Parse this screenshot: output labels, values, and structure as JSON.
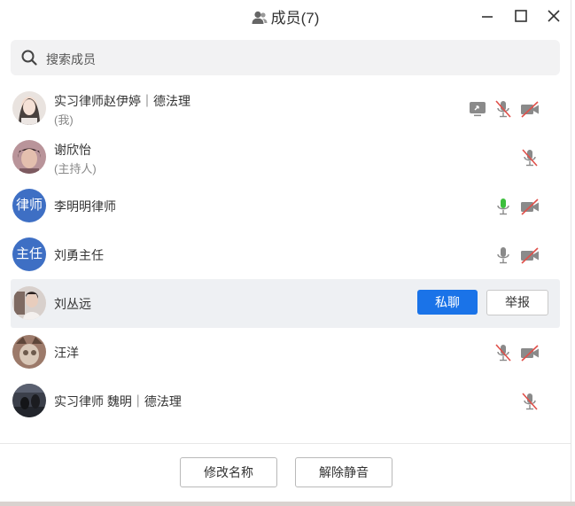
{
  "window": {
    "title": "成员(7)",
    "controls": [
      "minimize",
      "maximize",
      "close"
    ]
  },
  "search": {
    "placeholder": "搜索成员"
  },
  "members": [
    {
      "name": "实习律师赵伊婷｜德法理",
      "sub": "(我)",
      "avatar": "photo",
      "screen_share": true,
      "mic": "muted",
      "camera": "off"
    },
    {
      "name": "谢欣怡",
      "sub": "(主持人)",
      "avatar": "photo",
      "mic": "muted"
    },
    {
      "name": "李明明律师",
      "avatar_text": "律师",
      "mic": "active",
      "camera": "off"
    },
    {
      "name": "刘勇主任",
      "avatar_text": "主任",
      "mic": "on",
      "camera": "off"
    },
    {
      "name": "刘丛远",
      "avatar": "photo",
      "highlighted": true,
      "actions": {
        "chat_label": "私聊",
        "report_label": "举报"
      }
    },
    {
      "name": "汪洋",
      "avatar": "photo",
      "mic": "muted",
      "camera": "off"
    },
    {
      "name": "实习律师 魏明｜德法理",
      "avatar": "photo",
      "mic": "muted"
    }
  ],
  "footer": {
    "rename_label": "修改名称",
    "unmute_label": "解除静音"
  },
  "colors": {
    "accent": "#1a73e8",
    "avatar_blue": "#3e6fc4",
    "mic_active": "#3dbf3d",
    "muted_red": "#e0504a",
    "icon_gray": "#8a8a8a"
  }
}
